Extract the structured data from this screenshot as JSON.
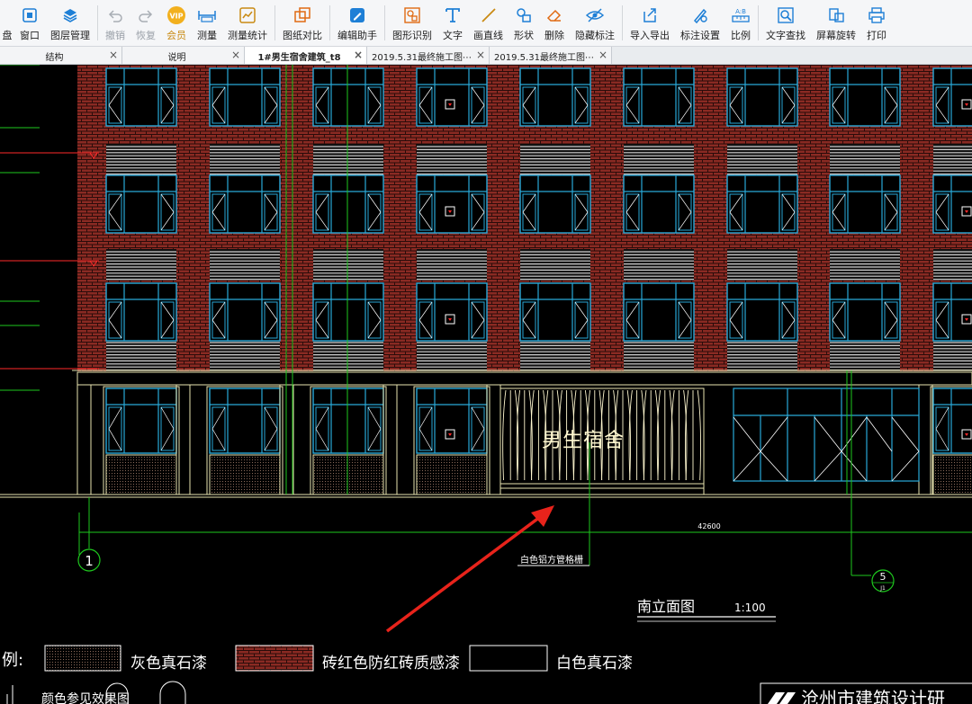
{
  "toolbar": {
    "items": [
      {
        "label": "盘",
        "icon": "disk-icon"
      },
      {
        "label": "窗口",
        "icon": "window-icon"
      },
      {
        "label": "图层管理",
        "icon": "layers-icon"
      },
      {
        "label": "撤销",
        "icon": "undo-icon",
        "disabled": true
      },
      {
        "label": "恢复",
        "icon": "redo-icon",
        "disabled": true
      },
      {
        "label": "会员",
        "icon": "vip-icon",
        "vip": true
      },
      {
        "label": "测量",
        "icon": "measure-icon"
      },
      {
        "label": "测量统计",
        "icon": "measure-stats-icon"
      },
      {
        "label": "图纸对比",
        "icon": "compare-icon"
      },
      {
        "label": "编辑助手",
        "icon": "edit-assistant-icon"
      },
      {
        "label": "图形识别",
        "icon": "shape-recognize-icon"
      },
      {
        "label": "文字",
        "icon": "text-icon"
      },
      {
        "label": "画直线",
        "icon": "line-icon"
      },
      {
        "label": "形状",
        "icon": "shape-icon"
      },
      {
        "label": "删除",
        "icon": "eraser-icon"
      },
      {
        "label": "隐藏标注",
        "icon": "hide-annotation-icon"
      },
      {
        "label": "导入导出",
        "icon": "import-export-icon"
      },
      {
        "label": "标注设置",
        "icon": "annotation-settings-icon"
      },
      {
        "label": "比例",
        "icon": "scale-icon"
      },
      {
        "label": "文字查找",
        "icon": "text-search-icon"
      },
      {
        "label": "屏幕旋转",
        "icon": "rotate-screen-icon"
      },
      {
        "label": "打印",
        "icon": "print-icon"
      }
    ]
  },
  "tabs": [
    {
      "label": "结构"
    },
    {
      "label": "说明"
    },
    {
      "label": "1#男生宿舍建筑_t8",
      "active": true
    },
    {
      "label": "2019.5.31最终施工图⋯"
    },
    {
      "label": "2019.5.31最终施工图⋯"
    }
  ],
  "drawing": {
    "entrance_sign": "男生宿舍",
    "dimension_value": "42600",
    "railing_note": "白色铝方管格栅",
    "axis_left": "1",
    "axis_right_top": "5",
    "axis_right_bottom": "J1",
    "title": "南立面图",
    "scale": "1:100",
    "legend_title": "例:",
    "legend": [
      {
        "label": "灰色真石漆"
      },
      {
        "label": "砖红色防红砖质感漆"
      },
      {
        "label": "白色真石漆"
      }
    ],
    "legend_sub": "颜色参见效果图",
    "watermark": "沧州市建筑设计研"
  },
  "colors": {
    "brick": "#8a2a23",
    "mortar": "#2a0c0a",
    "window_frame": "#29a9d8",
    "mullion": "#ffffff",
    "grid_green": "#1ec81e",
    "outline": "#e8e4b0",
    "annotation": "#ff2a2a",
    "louver": "#cfcfcf",
    "arrow": "#e8231b"
  }
}
